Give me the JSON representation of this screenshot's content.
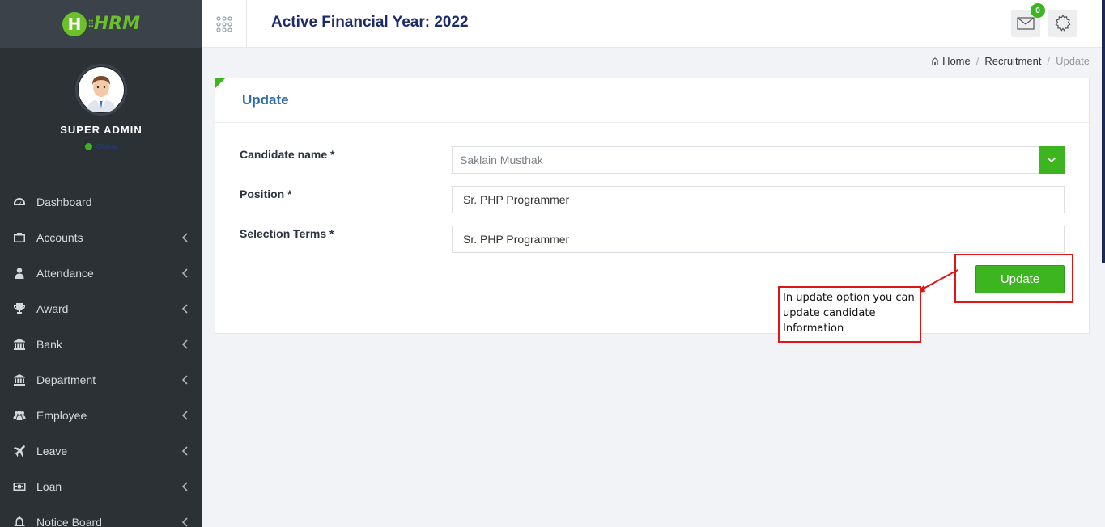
{
  "app": {
    "logo_letter": "H",
    "logo_text": "HRM",
    "financial_year_title": "Active Financial Year: 2022"
  },
  "colors": {
    "accent": "#3cb521",
    "sidebar": "#2c3136",
    "title": "#1d2b6b",
    "annotation": "#e01515"
  },
  "user": {
    "name": "SUPER ADMIN",
    "status": "Online"
  },
  "header": {
    "mail_badge": "0",
    "mail_icon": "envelope-icon",
    "settings_icon": "gear-icon",
    "apps_icon": "grid-icon"
  },
  "sidebar": {
    "items": [
      {
        "label": "Dashboard",
        "icon": "dashboard-icon"
      },
      {
        "label": "Accounts",
        "icon": "briefcase-icon"
      },
      {
        "label": "Attendance",
        "icon": "user-icon"
      },
      {
        "label": "Award",
        "icon": "trophy-icon"
      },
      {
        "label": "Bank",
        "icon": "bank-icon"
      },
      {
        "label": "Department",
        "icon": "bank-icon"
      },
      {
        "label": "Employee",
        "icon": "users-icon"
      },
      {
        "label": "Leave",
        "icon": "plane-icon"
      },
      {
        "label": "Loan",
        "icon": "money-icon"
      },
      {
        "label": "Notice Board",
        "icon": "bell-icon"
      }
    ]
  },
  "breadcrumb": {
    "home": "Home",
    "section": "Recruitment",
    "current": "Update"
  },
  "form": {
    "title": "Update",
    "candidate_label": "Candidate name *",
    "candidate_value": "Saklain Musthak",
    "position_label": "Position *",
    "position_value": "Sr. PHP Programmer",
    "terms_label": "Selection Terms *",
    "terms_value": "Sr. PHP Programmer",
    "submit_label": "Update"
  },
  "annotation": {
    "note": "In update option you can update candidate Information"
  }
}
